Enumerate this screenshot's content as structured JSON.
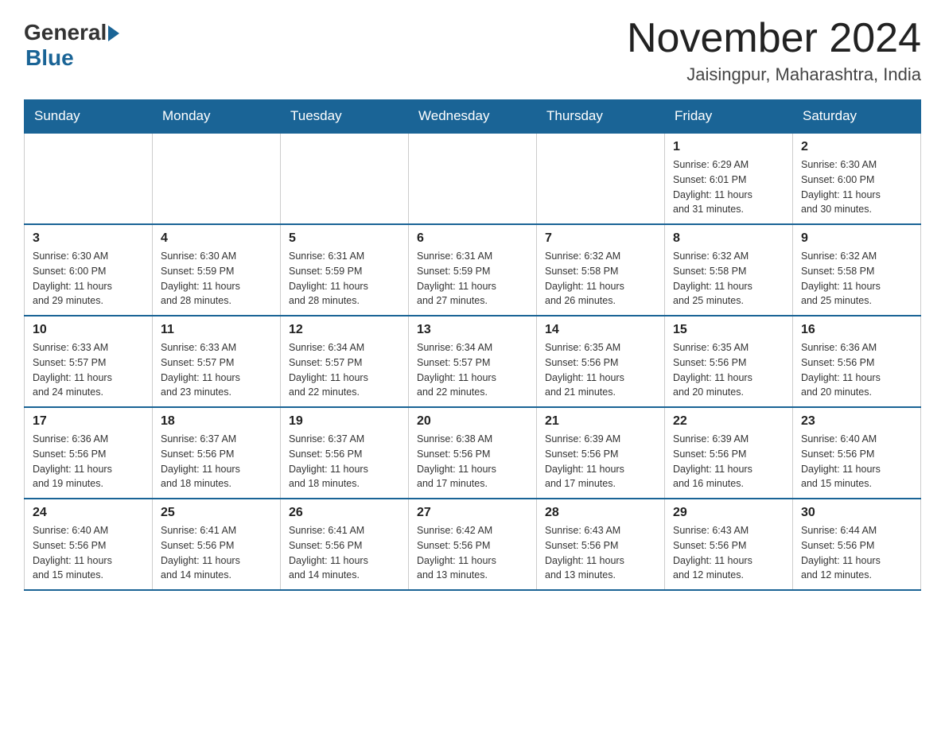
{
  "header": {
    "logo": {
      "general": "General",
      "blue": "Blue"
    },
    "title": "November 2024",
    "location": "Jaisingpur, Maharashtra, India"
  },
  "weekdays": [
    "Sunday",
    "Monday",
    "Tuesday",
    "Wednesday",
    "Thursday",
    "Friday",
    "Saturday"
  ],
  "weeks": [
    [
      {
        "day": "",
        "info": ""
      },
      {
        "day": "",
        "info": ""
      },
      {
        "day": "",
        "info": ""
      },
      {
        "day": "",
        "info": ""
      },
      {
        "day": "",
        "info": ""
      },
      {
        "day": "1",
        "info": "Sunrise: 6:29 AM\nSunset: 6:01 PM\nDaylight: 11 hours\nand 31 minutes."
      },
      {
        "day": "2",
        "info": "Sunrise: 6:30 AM\nSunset: 6:00 PM\nDaylight: 11 hours\nand 30 minutes."
      }
    ],
    [
      {
        "day": "3",
        "info": "Sunrise: 6:30 AM\nSunset: 6:00 PM\nDaylight: 11 hours\nand 29 minutes."
      },
      {
        "day": "4",
        "info": "Sunrise: 6:30 AM\nSunset: 5:59 PM\nDaylight: 11 hours\nand 28 minutes."
      },
      {
        "day": "5",
        "info": "Sunrise: 6:31 AM\nSunset: 5:59 PM\nDaylight: 11 hours\nand 28 minutes."
      },
      {
        "day": "6",
        "info": "Sunrise: 6:31 AM\nSunset: 5:59 PM\nDaylight: 11 hours\nand 27 minutes."
      },
      {
        "day": "7",
        "info": "Sunrise: 6:32 AM\nSunset: 5:58 PM\nDaylight: 11 hours\nand 26 minutes."
      },
      {
        "day": "8",
        "info": "Sunrise: 6:32 AM\nSunset: 5:58 PM\nDaylight: 11 hours\nand 25 minutes."
      },
      {
        "day": "9",
        "info": "Sunrise: 6:32 AM\nSunset: 5:58 PM\nDaylight: 11 hours\nand 25 minutes."
      }
    ],
    [
      {
        "day": "10",
        "info": "Sunrise: 6:33 AM\nSunset: 5:57 PM\nDaylight: 11 hours\nand 24 minutes."
      },
      {
        "day": "11",
        "info": "Sunrise: 6:33 AM\nSunset: 5:57 PM\nDaylight: 11 hours\nand 23 minutes."
      },
      {
        "day": "12",
        "info": "Sunrise: 6:34 AM\nSunset: 5:57 PM\nDaylight: 11 hours\nand 22 minutes."
      },
      {
        "day": "13",
        "info": "Sunrise: 6:34 AM\nSunset: 5:57 PM\nDaylight: 11 hours\nand 22 minutes."
      },
      {
        "day": "14",
        "info": "Sunrise: 6:35 AM\nSunset: 5:56 PM\nDaylight: 11 hours\nand 21 minutes."
      },
      {
        "day": "15",
        "info": "Sunrise: 6:35 AM\nSunset: 5:56 PM\nDaylight: 11 hours\nand 20 minutes."
      },
      {
        "day": "16",
        "info": "Sunrise: 6:36 AM\nSunset: 5:56 PM\nDaylight: 11 hours\nand 20 minutes."
      }
    ],
    [
      {
        "day": "17",
        "info": "Sunrise: 6:36 AM\nSunset: 5:56 PM\nDaylight: 11 hours\nand 19 minutes."
      },
      {
        "day": "18",
        "info": "Sunrise: 6:37 AM\nSunset: 5:56 PM\nDaylight: 11 hours\nand 18 minutes."
      },
      {
        "day": "19",
        "info": "Sunrise: 6:37 AM\nSunset: 5:56 PM\nDaylight: 11 hours\nand 18 minutes."
      },
      {
        "day": "20",
        "info": "Sunrise: 6:38 AM\nSunset: 5:56 PM\nDaylight: 11 hours\nand 17 minutes."
      },
      {
        "day": "21",
        "info": "Sunrise: 6:39 AM\nSunset: 5:56 PM\nDaylight: 11 hours\nand 17 minutes."
      },
      {
        "day": "22",
        "info": "Sunrise: 6:39 AM\nSunset: 5:56 PM\nDaylight: 11 hours\nand 16 minutes."
      },
      {
        "day": "23",
        "info": "Sunrise: 6:40 AM\nSunset: 5:56 PM\nDaylight: 11 hours\nand 15 minutes."
      }
    ],
    [
      {
        "day": "24",
        "info": "Sunrise: 6:40 AM\nSunset: 5:56 PM\nDaylight: 11 hours\nand 15 minutes."
      },
      {
        "day": "25",
        "info": "Sunrise: 6:41 AM\nSunset: 5:56 PM\nDaylight: 11 hours\nand 14 minutes."
      },
      {
        "day": "26",
        "info": "Sunrise: 6:41 AM\nSunset: 5:56 PM\nDaylight: 11 hours\nand 14 minutes."
      },
      {
        "day": "27",
        "info": "Sunrise: 6:42 AM\nSunset: 5:56 PM\nDaylight: 11 hours\nand 13 minutes."
      },
      {
        "day": "28",
        "info": "Sunrise: 6:43 AM\nSunset: 5:56 PM\nDaylight: 11 hours\nand 13 minutes."
      },
      {
        "day": "29",
        "info": "Sunrise: 6:43 AM\nSunset: 5:56 PM\nDaylight: 11 hours\nand 12 minutes."
      },
      {
        "day": "30",
        "info": "Sunrise: 6:44 AM\nSunset: 5:56 PM\nDaylight: 11 hours\nand 12 minutes."
      }
    ]
  ]
}
